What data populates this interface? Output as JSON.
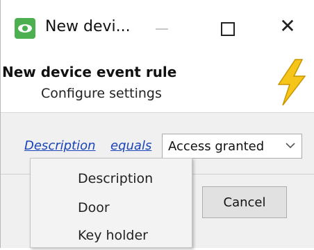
{
  "window": {
    "title": "New devi...",
    "minimize_icon": "minimize-icon",
    "maximize_icon": "maximize-icon",
    "close_glyph": "✕",
    "app_icon": "eye-icon"
  },
  "header": {
    "title": "New device event rule",
    "subtitle": "Configure settings",
    "icon": "lightning-bolt-icon",
    "icon_color": "#f5c518"
  },
  "rule": {
    "field_link": "Description",
    "operator_link": "equals",
    "value_select": "Access granted",
    "link_color": "#1a43b8"
  },
  "buttons": {
    "cancel": "Cancel"
  },
  "menu": {
    "items": [
      {
        "label": "Description"
      },
      {
        "label": "Door"
      },
      {
        "label": "Key holder"
      }
    ]
  }
}
